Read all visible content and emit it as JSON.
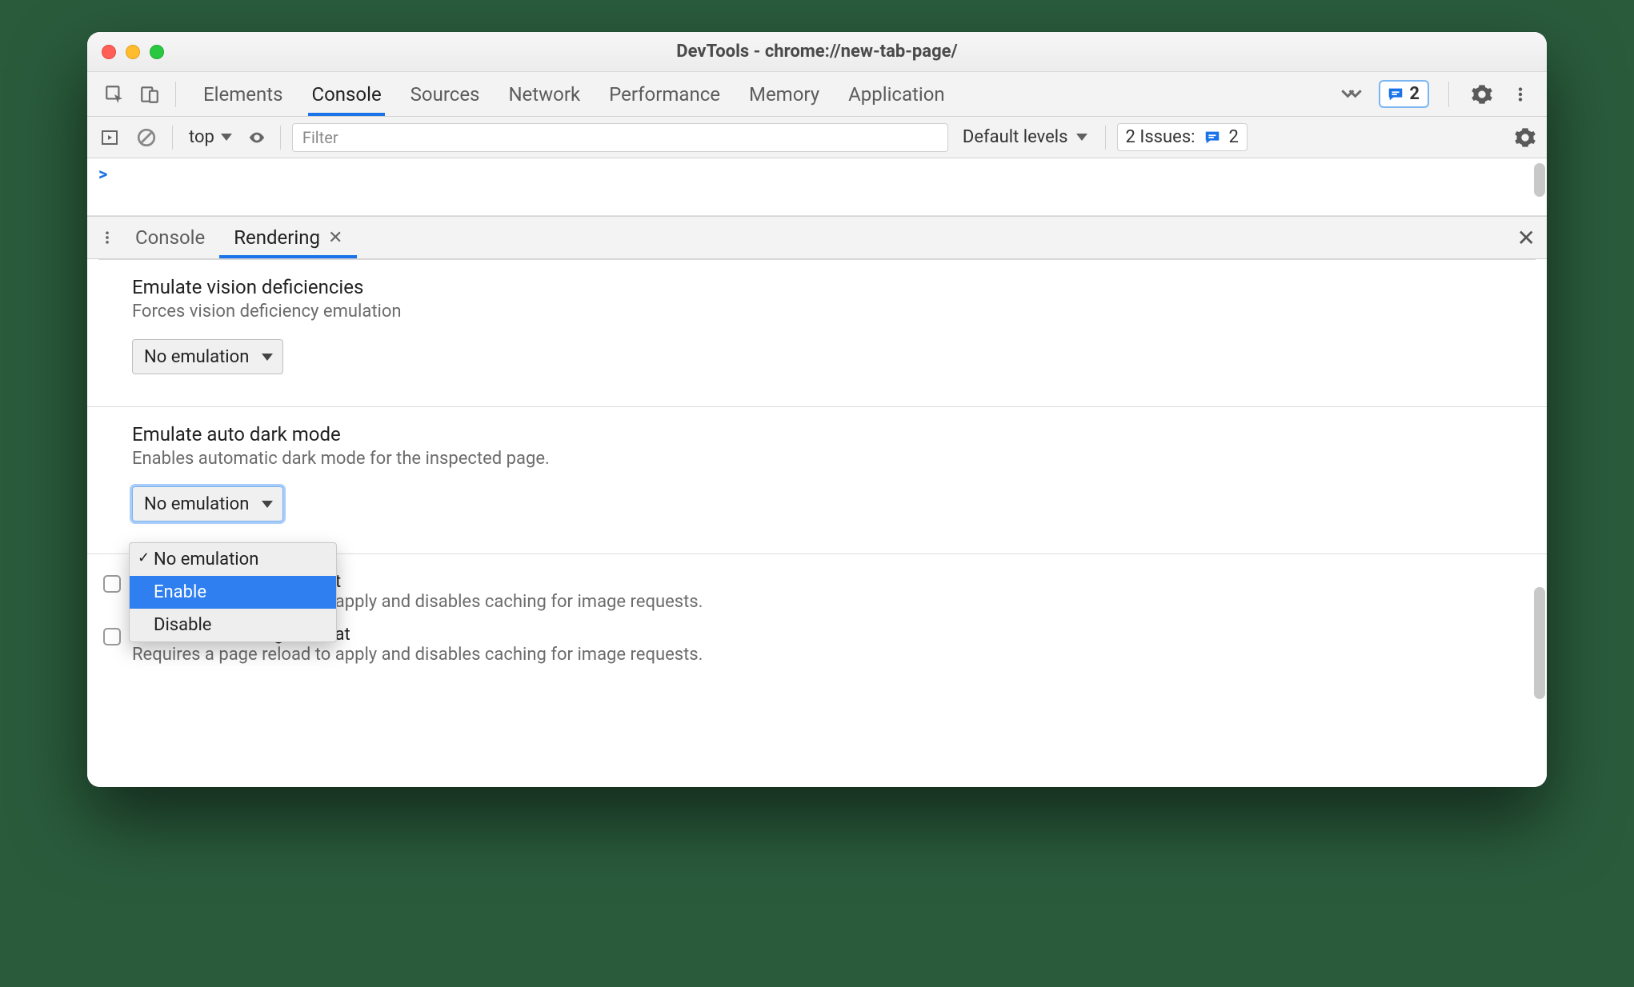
{
  "window": {
    "title": "DevTools - chrome://new-tab-page/"
  },
  "tabs": {
    "items": [
      "Elements",
      "Console",
      "Sources",
      "Network",
      "Performance",
      "Memory",
      "Application"
    ],
    "active": "Console",
    "overflow_badge_count": "2"
  },
  "console_toolbar": {
    "context_label": "top",
    "filter_placeholder": "Filter",
    "levels_label": "Default levels",
    "issues_label": "2 Issues:",
    "issues_count": "2"
  },
  "console_prompt": {
    "chevron": ">"
  },
  "drawer": {
    "tabs": [
      "Console",
      "Rendering"
    ],
    "active": "Rendering"
  },
  "rendering": {
    "vision": {
      "title": "Emulate vision deficiencies",
      "desc": "Forces vision deficiency emulation",
      "select_value": "No emulation"
    },
    "darkmode": {
      "title": "Emulate auto dark mode",
      "desc": "Enables automatic dark mode for the inspected page.",
      "select_value": "No emulation",
      "options": [
        "No emulation",
        "Enable",
        "Disable"
      ],
      "highlighted": "Enable"
    },
    "avif": {
      "label": "Disable AVIF image format",
      "desc": "Requires a page reload to apply and disables caching for image requests."
    },
    "webp": {
      "label": "Disable WebP image format",
      "desc": "Requires a page reload to apply and disables caching for image requests."
    }
  }
}
